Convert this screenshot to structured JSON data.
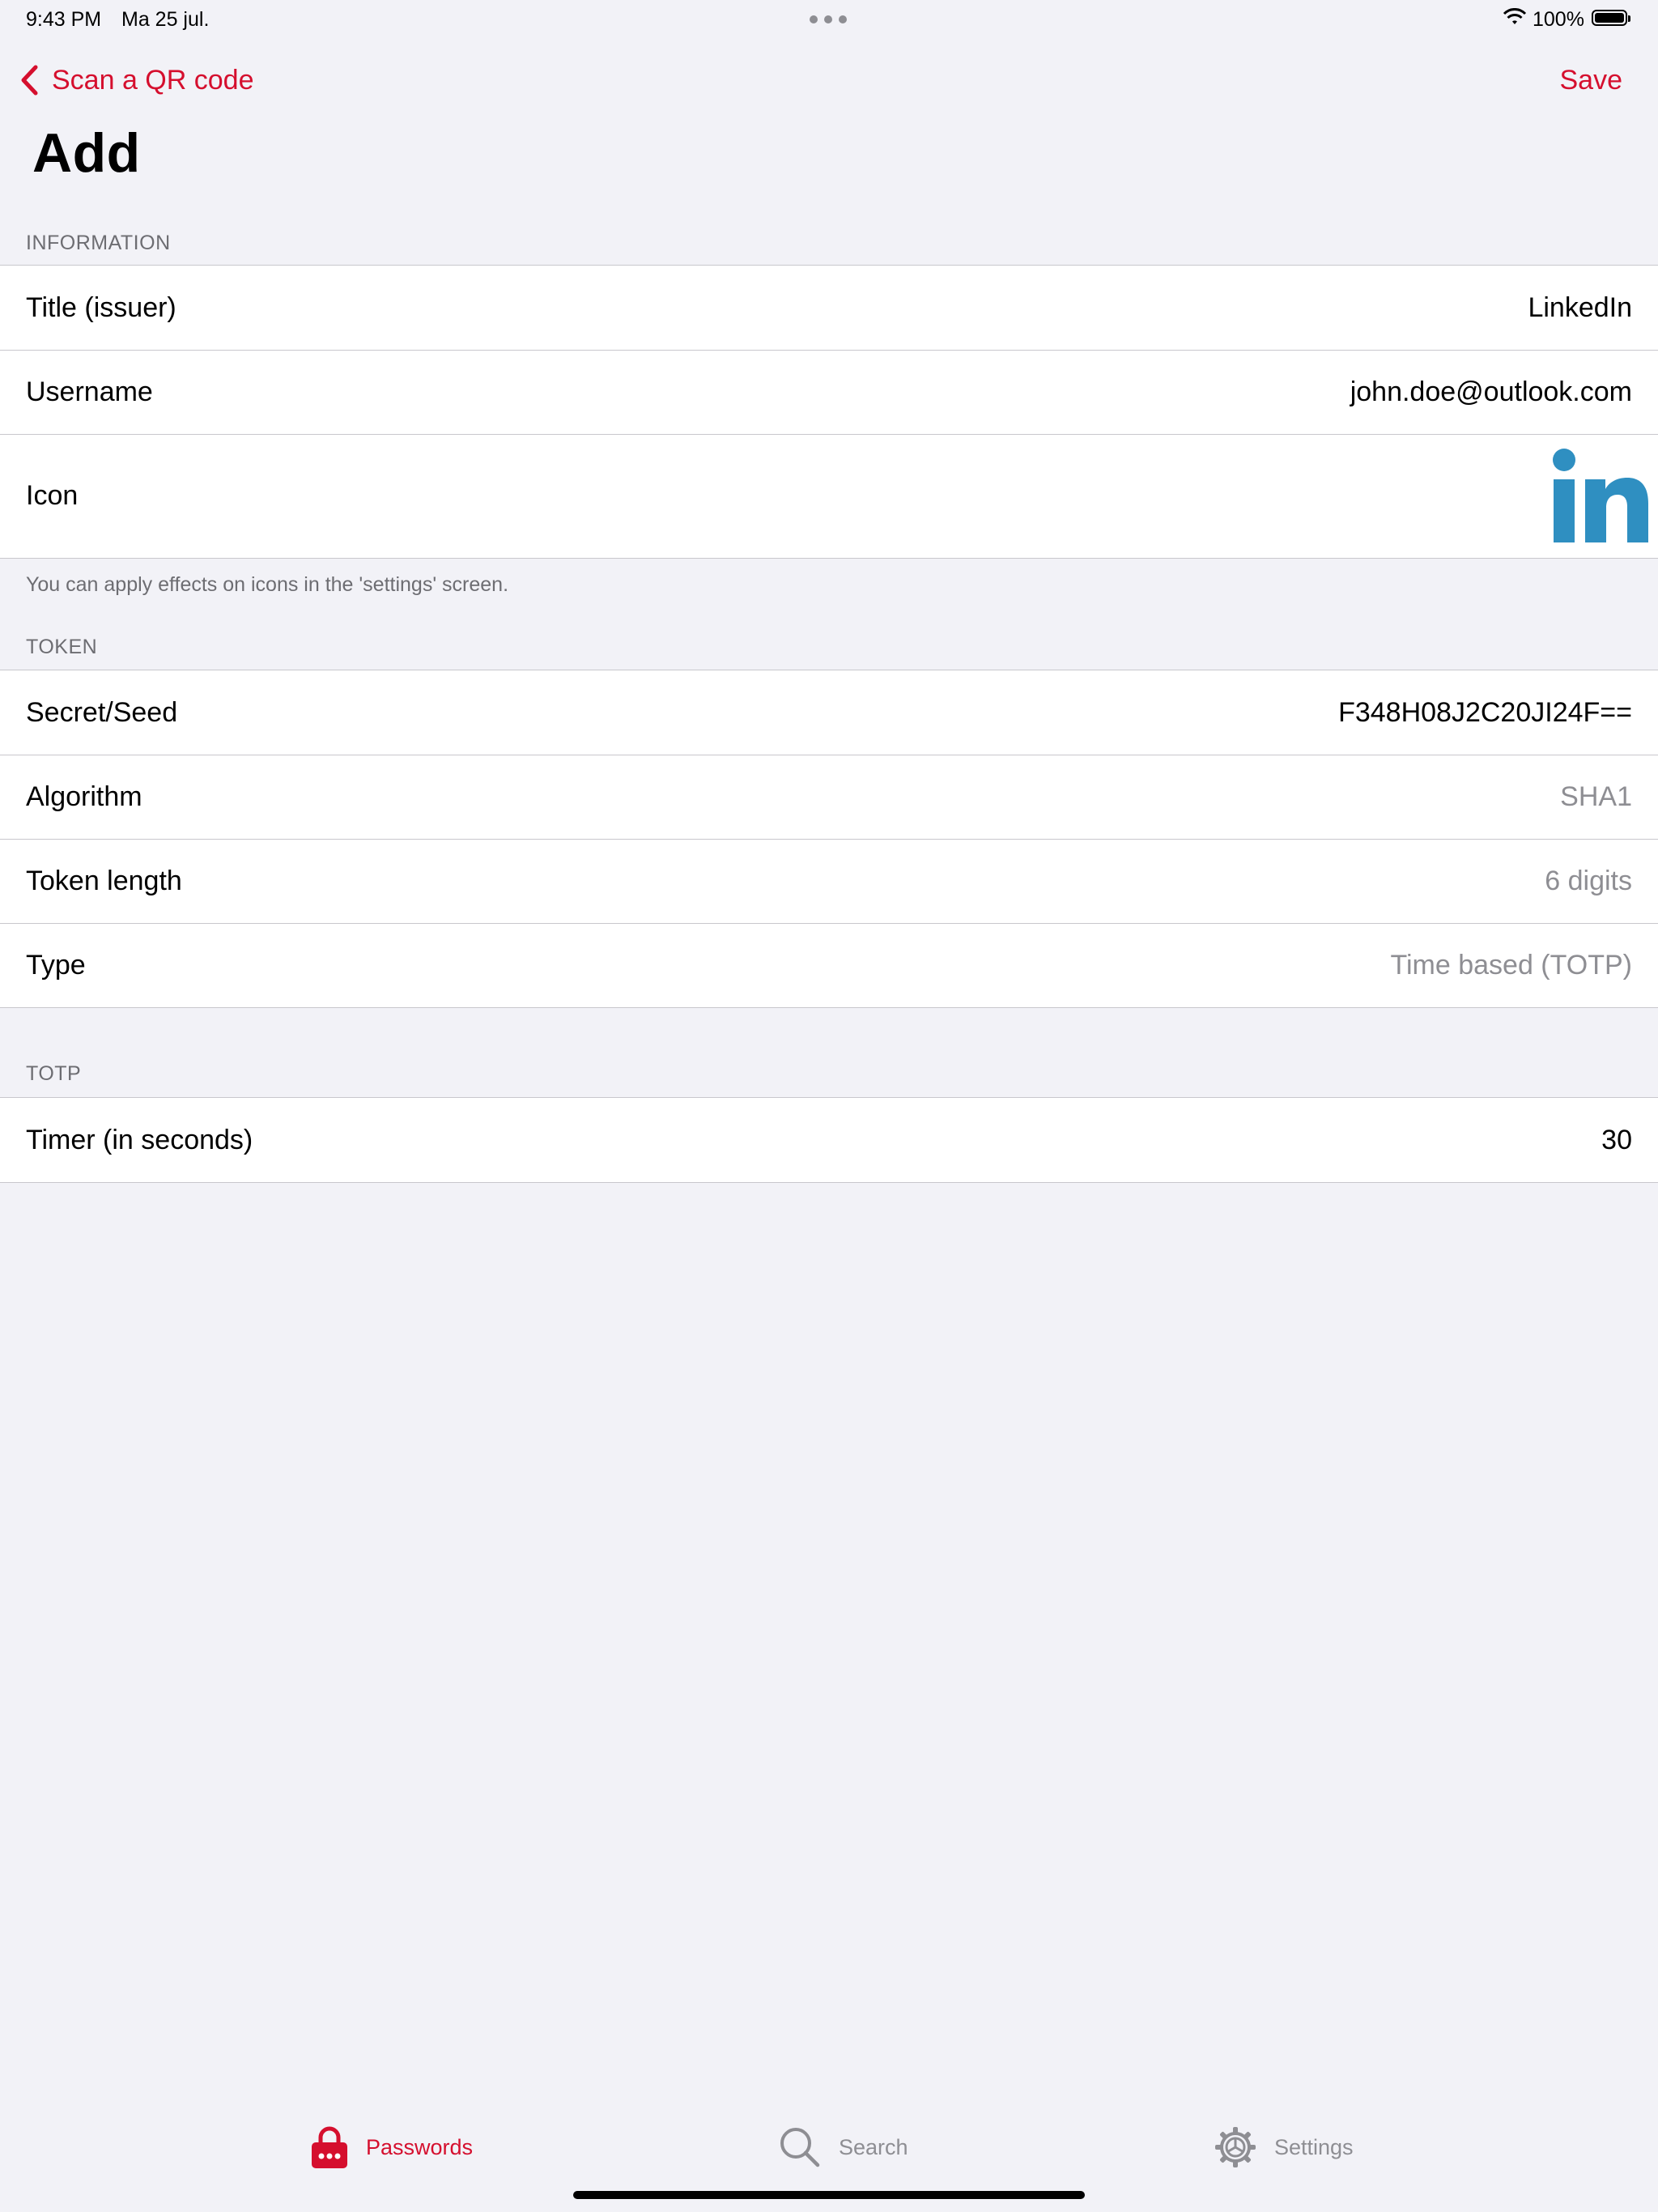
{
  "status_bar": {
    "time": "9:43 PM",
    "date": "Ma 25 jul.",
    "battery_pct": "100%",
    "icons": [
      "wifi-icon",
      "battery-icon",
      "multitask-dots-icon"
    ]
  },
  "nav": {
    "back_label": "Scan a QR code",
    "save_label": "Save",
    "title": "Add",
    "accent_color": "#d50f2e"
  },
  "sections": {
    "information": {
      "header": "INFORMATION",
      "rows": {
        "title": {
          "label": "Title (issuer)",
          "value": "LinkedIn"
        },
        "username": {
          "label": "Username",
          "value": "john.doe@outlook.com"
        },
        "icon": {
          "label": "Icon",
          "value_icon": "linkedin-logo",
          "logo_color": "#2f8fc1"
        }
      },
      "footer": "You can apply effects on icons in the 'settings' screen."
    },
    "token": {
      "header": "TOKEN",
      "rows": {
        "secret": {
          "label": "Secret/Seed",
          "value": "F348H08J2C20JI24F=="
        },
        "algorithm": {
          "label": "Algorithm",
          "value": "SHA1"
        },
        "length": {
          "label": "Token length",
          "value": "6 digits"
        },
        "type": {
          "label": "Type",
          "value": "Time based (TOTP)"
        }
      }
    },
    "totp": {
      "header": "TOTP",
      "rows": {
        "timer": {
          "label": "Timer (in seconds)",
          "value": "30"
        }
      }
    }
  },
  "tab_bar": {
    "tabs": [
      {
        "label": "Passwords",
        "icon": "lock-icon",
        "selected": true
      },
      {
        "label": "Search",
        "icon": "magnifier-icon",
        "selected": false
      },
      {
        "label": "Settings",
        "icon": "gear-icon",
        "selected": false
      }
    ]
  }
}
